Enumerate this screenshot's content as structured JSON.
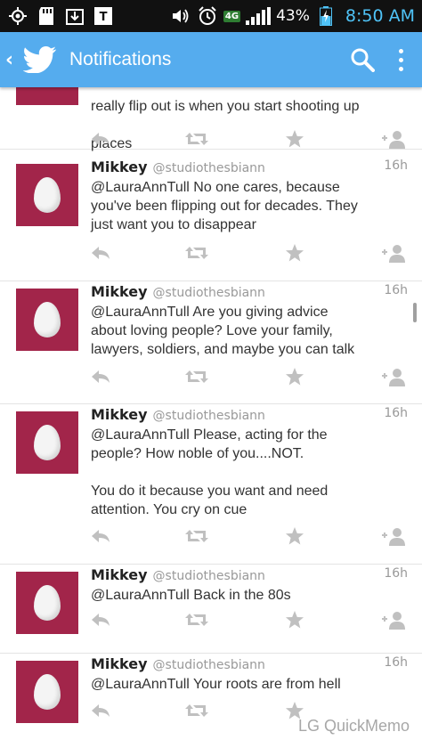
{
  "status_bar": {
    "battery_percent": "43%",
    "time": "8:50 AM",
    "network": "4G",
    "icons": [
      "gps-icon",
      "sd-card-icon",
      "download-icon",
      "tmobile-icon",
      "volume-icon",
      "alarm-icon",
      "lte-icon",
      "signal-icon",
      "battery-charging-icon"
    ]
  },
  "app_bar": {
    "title": "Notifications",
    "icons": [
      "back-icon",
      "twitter-bird-icon",
      "search-icon",
      "overflow-menu-icon"
    ],
    "brand_color": "#55acee"
  },
  "avatar_color": "#a2254a",
  "partial_tweet": {
    "line1": "really flip out is when you start shooting up",
    "line2": "places"
  },
  "tweets": [
    {
      "name": "Mikkey",
      "handle": "@studiothesbiann",
      "time": "16h",
      "text": "@LauraAnnTull No one cares, because\nyou've been flipping out for decades. They\njust want you to disappear"
    },
    {
      "name": "Mikkey",
      "handle": "@studiothesbiann",
      "time": "16h",
      "text": "@LauraAnnTull Are you giving advice\nabout loving people? Love your family,\nlawyers, soldiers, and maybe you can talk"
    },
    {
      "name": "Mikkey",
      "handle": "@studiothesbiann",
      "time": "16h",
      "text": "@LauraAnnTull Please, acting for the\npeople? How noble of you....NOT.\n\nYou do it because you want and need\nattention. You cry on cue"
    },
    {
      "name": "Mikkey",
      "handle": "@studiothesbiann",
      "time": "16h",
      "text": "@LauraAnnTull Back in the 80s"
    },
    {
      "name": "Mikkey",
      "handle": "@studiothesbiann",
      "time": "16h",
      "text": "@LauraAnnTull Your roots are from hell"
    }
  ],
  "watermark": "LG QuickMemo"
}
